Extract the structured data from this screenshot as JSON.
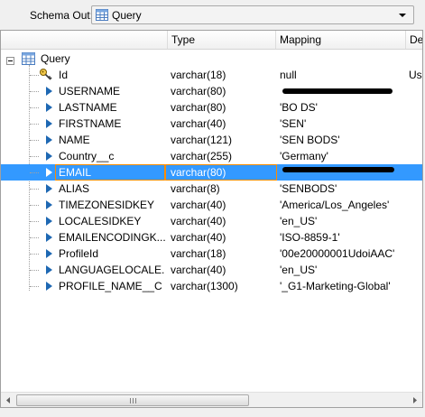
{
  "schema_out": {
    "label": "Schema Out:",
    "value": "Query"
  },
  "columns": [
    "Type",
    "Mapping",
    "De"
  ],
  "tree_root": "Query",
  "rows": [
    {
      "name": "Id",
      "type": "varchar(18)",
      "mapping": "null",
      "extra": "Use",
      "icon": "key-icon",
      "selected": false,
      "redacted": false
    },
    {
      "name": "USERNAME",
      "type": "varchar(80)",
      "mapping": "",
      "extra": "",
      "icon": "triangle",
      "selected": false,
      "redacted": true
    },
    {
      "name": "LASTNAME",
      "type": "varchar(80)",
      "mapping": "'BO DS'",
      "extra": "",
      "icon": "triangle",
      "selected": false,
      "redacted": false
    },
    {
      "name": "FIRSTNAME",
      "type": "varchar(40)",
      "mapping": "'SEN'",
      "extra": "",
      "icon": "triangle",
      "selected": false,
      "redacted": false
    },
    {
      "name": "NAME",
      "type": "varchar(121)",
      "mapping": "'SEN BODS'",
      "extra": "",
      "icon": "triangle",
      "selected": false,
      "redacted": false
    },
    {
      "name": "Country__c",
      "type": "varchar(255)",
      "mapping": "'Germany'",
      "extra": "",
      "icon": "triangle",
      "selected": false,
      "redacted": false
    },
    {
      "name": "EMAIL",
      "type": "varchar(80)",
      "mapping": "",
      "extra": "",
      "icon": "triangle",
      "selected": true,
      "redacted": true
    },
    {
      "name": "ALIAS",
      "type": "varchar(8)",
      "mapping": "'SENBODS'",
      "extra": "",
      "icon": "triangle",
      "selected": false,
      "redacted": false
    },
    {
      "name": "TIMEZONESIDKEY",
      "type": "varchar(40)",
      "mapping": "'America/Los_Angeles'",
      "extra": "",
      "icon": "triangle",
      "selected": false,
      "redacted": false
    },
    {
      "name": "LOCALESIDKEY",
      "type": "varchar(40)",
      "mapping": "'en_US'",
      "extra": "",
      "icon": "triangle",
      "selected": false,
      "redacted": false
    },
    {
      "name": "EMAILENCODINGK...",
      "type": "varchar(40)",
      "mapping": "'ISO-8859-1'",
      "extra": "",
      "icon": "triangle",
      "selected": false,
      "redacted": false
    },
    {
      "name": "ProfileId",
      "type": "varchar(18)",
      "mapping": "'00e20000001UdoiAAC'",
      "extra": "",
      "icon": "triangle",
      "selected": false,
      "redacted": false
    },
    {
      "name": "LANGUAGELOCALE...",
      "type": "varchar(40)",
      "mapping": "'en_US'",
      "extra": "",
      "icon": "triangle",
      "selected": false,
      "redacted": false
    },
    {
      "name": "PROFILE_NAME__C",
      "type": "varchar(1300)",
      "mapping": "'_G1-Marketing-Global'",
      "extra": "",
      "icon": "triangle",
      "selected": false,
      "redacted": false
    }
  ],
  "colors": {
    "selection": "#3399ff",
    "focus_border": "#ff8c00",
    "triangle": "#1e68b3"
  }
}
